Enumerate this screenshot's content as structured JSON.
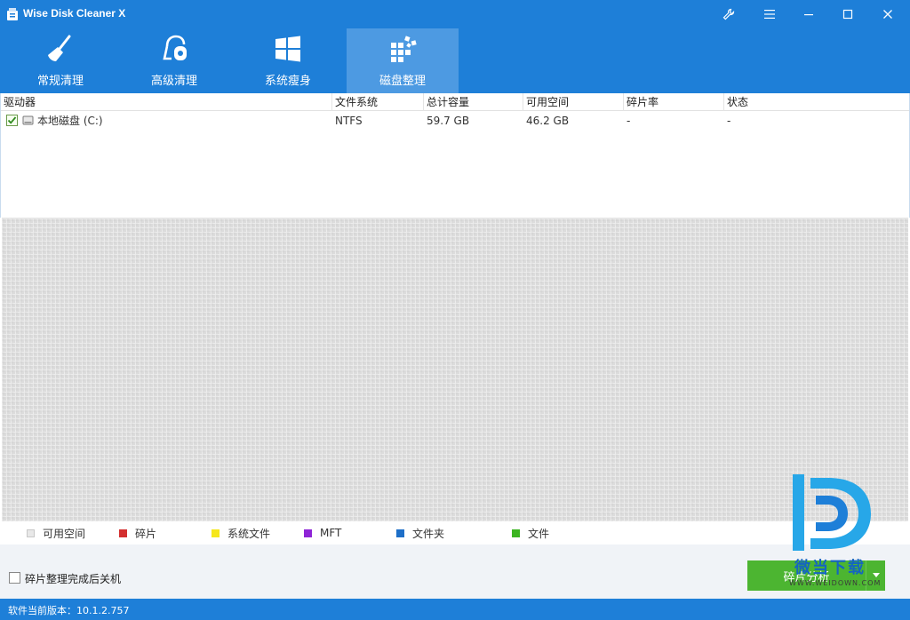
{
  "window": {
    "title": "Wise Disk Cleaner X"
  },
  "window_controls": [
    {
      "name": "settings-icon"
    },
    {
      "name": "menu-icon"
    },
    {
      "name": "minimize-icon"
    },
    {
      "name": "maximize-icon"
    },
    {
      "name": "close-icon"
    }
  ],
  "nav": {
    "tabs": [
      {
        "label": "常规清理",
        "icon": "broom-icon",
        "active": false
      },
      {
        "label": "高级清理",
        "icon": "vacuum-icon",
        "active": false
      },
      {
        "label": "系统瘦身",
        "icon": "windows-icon",
        "active": false
      },
      {
        "label": "磁盘整理",
        "icon": "defrag-icon",
        "active": true
      }
    ]
  },
  "drive_list": {
    "columns": [
      "驱动器",
      "文件系统",
      "总计容量",
      "可用空间",
      "碎片率",
      "状态"
    ],
    "rows": [
      {
        "checked": true,
        "drive": "本地磁盘 (C:)",
        "fs": "NTFS",
        "total": "59.7 GB",
        "free": "46.2 GB",
        "frag": "-",
        "status": "-"
      }
    ]
  },
  "legend": [
    {
      "label": "可用空间",
      "color": "#e8e8e8"
    },
    {
      "label": "碎片",
      "color": "#d32f2f"
    },
    {
      "label": "系统文件",
      "color": "#f5e71c"
    },
    {
      "label": "MFT",
      "color": "#8e24d6"
    },
    {
      "label": "文件夹",
      "color": "#1e6fc8"
    },
    {
      "label": "文件",
      "color": "#3cb521"
    }
  ],
  "bottom": {
    "shutdown_label": "碎片整理完成后关机",
    "analyze_button": "碎片分析"
  },
  "watermark": {
    "text": "微当下载",
    "url": "WWW.WEIDOWN.COM"
  },
  "status": {
    "version_text": "软件当前版本：10.1.2.757"
  },
  "colors": {
    "accent": "#1e7fd8",
    "active_tab": "#4d9ae2",
    "button_green": "#4cb531"
  }
}
